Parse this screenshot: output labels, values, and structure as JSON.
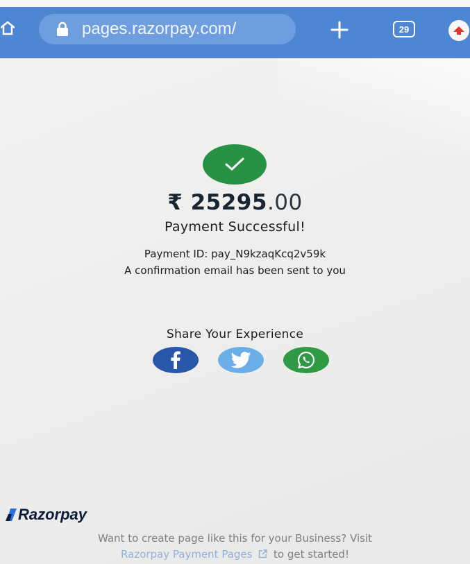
{
  "browser": {
    "url": "pages.razorpay.com/",
    "tab_count": "29",
    "icons": [
      "home-icon",
      "lock-icon",
      "plus-icon",
      "tabs-icon",
      "profile-icon"
    ],
    "toolbar_color": "#4d86d3"
  },
  "payment": {
    "currency_symbol": "₹",
    "amount_whole": "25295",
    "amount_decimal": ".00",
    "status": "Payment Successful!",
    "payment_id": "Payment ID: pay_N9kzaqKcq2v59k",
    "confirmation": "A confirmation email has been sent to you",
    "success_color": "#279244"
  },
  "share": {
    "title": "Share Your Experience",
    "networks": [
      {
        "name": "facebook-icon",
        "color": "#2856a8"
      },
      {
        "name": "twitter-icon",
        "color": "#6aaee8"
      },
      {
        "name": "whatsapp-icon",
        "color": "#2e9a43"
      }
    ]
  },
  "footer": {
    "brand": "Razorpay",
    "line1": "Want to create page like this for your Business? Visit",
    "link_text": "Razorpay Payment Pages",
    "line2_suffix": "to get started!"
  }
}
